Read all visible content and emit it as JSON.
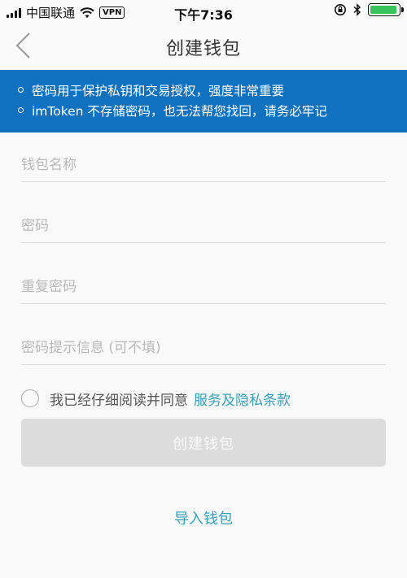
{
  "status_bar": {
    "carrier": "中国联通",
    "vpn": "VPN",
    "time": "下午7:36",
    "battery_level": 0.95,
    "battery_color": "#38c45a"
  },
  "nav": {
    "back_icon": "chevron-left-icon",
    "title": "创建钱包"
  },
  "info_banner": {
    "background": "#1071bf",
    "lines": [
      "密码用于保护私钥和交易授权，强度非常重要",
      "imToken 不存储密码，也无法帮您找回，请务必牢记"
    ]
  },
  "form": {
    "wallet_name_placeholder": "钱包名称",
    "password_placeholder": "密码",
    "repeat_password_placeholder": "重复密码",
    "hint_placeholder": "密码提示信息 (可不填)"
  },
  "agreement": {
    "text": "我已经仔细阅读并同意",
    "link_label": "服务及隐私条款",
    "link_color": "#3a9eb4"
  },
  "create_button_label": "创建钱包",
  "import_link_label": "导入钱包"
}
